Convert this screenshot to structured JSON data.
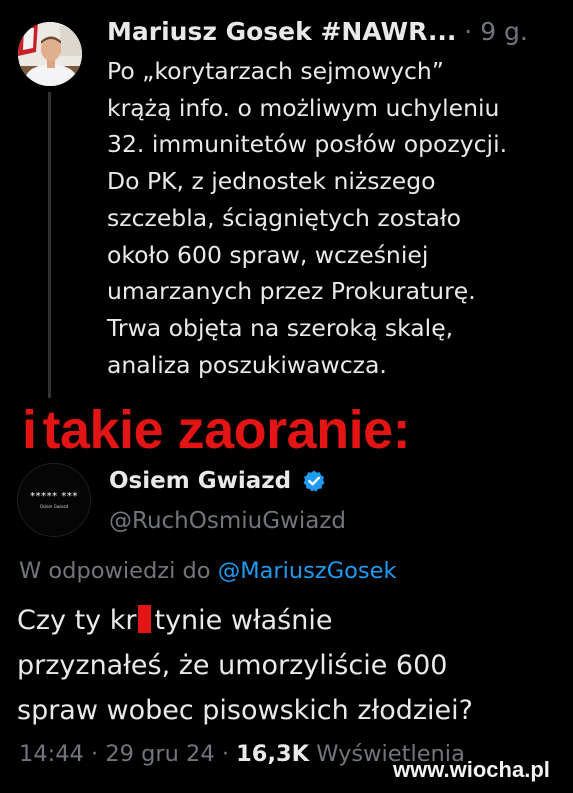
{
  "tweet_1": {
    "author_name": "Mariusz Gosek #NAWR...",
    "separator": "·",
    "time_ago": "9 g.",
    "lines": [
      "Po „korytarzach sejmowych”",
      "krążą info. o możliwym uchyleniu",
      "32. immunitetów posłów opozycji.",
      "Do PK, z jednostek niższego",
      "szczebla, ściągniętych zostało",
      "około 600 spraw, wcześniej",
      "umarzanych przez Prokuraturę.",
      "Trwa objęta na szeroką skalę,",
      "analiza poszukiwawcza."
    ]
  },
  "overlay": {
    "caption_part_1": "i",
    "caption_part_2": "takie zaoranie:",
    "color": "#e31414"
  },
  "tweet_2": {
    "avatar_stars": "***** ***",
    "avatar_subtitle": "Osiem Gwiazd",
    "author_name": "Osiem Gwiazd",
    "handle": "@RuchOsmiuGwiazd",
    "replying_to_label": "W odpowiedzi do",
    "replying_to_handle": "@MariuszGosek",
    "line_1_before": "Czy ty kr",
    "line_1_after": "tynie właśnie",
    "line_2": "przyznałeś, że umorzyliście 600",
    "line_3": "spraw wobec pisowskich złodziei?",
    "time": "14:44",
    "separator": "·",
    "date": "29 gru 24",
    "views_count": "16,3K",
    "views_label": "Wyświetlenia"
  },
  "watermark": "www.wiocha.pl",
  "colors": {
    "background": "#000000",
    "text_primary": "#e7e9ea",
    "text_secondary": "#71767b",
    "link": "#1d9bf0",
    "verified": "#1d9bf0",
    "thread_line": "#2f3336"
  },
  "icons": {
    "verified": "verified-badge-icon"
  }
}
